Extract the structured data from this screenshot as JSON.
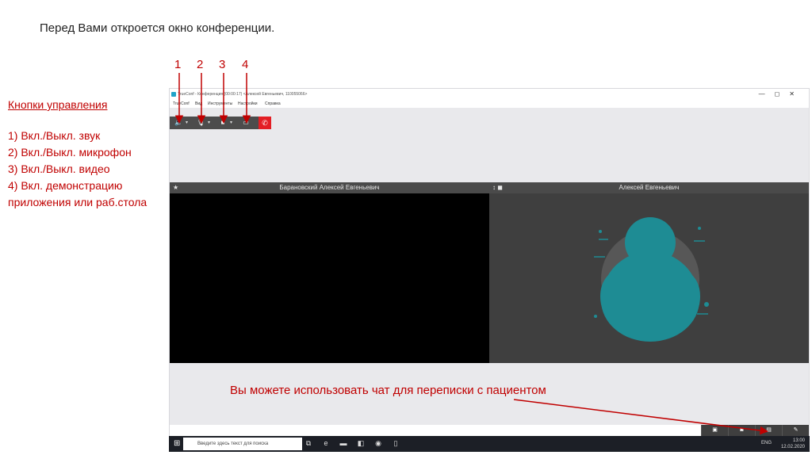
{
  "slide": {
    "title": "Перед Вами откроется окно конференции.",
    "controls_heading": "Кнопки управления",
    "controls": [
      "1)    Вкл./Выкл. звук",
      "2)    Вкл./Выкл. микрофон",
      "3)    Вкл./Выкл. видео",
      "4)    Вкл. демонстрацию",
      " приложения или раб.стола"
    ],
    "numbers": [
      "1",
      "2",
      "3",
      "4"
    ],
    "chat_note": "Вы можете использовать чат для переписки с пациентом",
    "accent_color": "#c00000"
  },
  "window": {
    "title": "TrueConf - Конференция (00:00:17) <Алексей Евгеньевич, 110055066>",
    "menu": [
      "TrueConf",
      "Вид",
      "Инструменты",
      "Настройки",
      "Справка"
    ],
    "controls": [
      "—",
      "◻",
      "✕"
    ],
    "toolbar_icons": [
      "speaker-icon",
      "microphone-icon",
      "camera-icon",
      "screen-share-icon",
      "hangup-icon"
    ],
    "participants": [
      {
        "name": "Барановский Алексей Евгеньевич",
        "lead_icon": "★"
      },
      {
        "name": "Алексей Евгеньевич",
        "lead_icon": "↕ ◼"
      }
    ],
    "avatar_color": "#1e8c94",
    "bottom_buttons": [
      "contact-card-icon",
      "gallery-icon",
      "chat-icon",
      "edit-icon"
    ]
  },
  "taskbar": {
    "search_placeholder": "Введите здесь текст для поиска",
    "language": "ENG",
    "time": "13:00",
    "date": "12.02.2020"
  }
}
